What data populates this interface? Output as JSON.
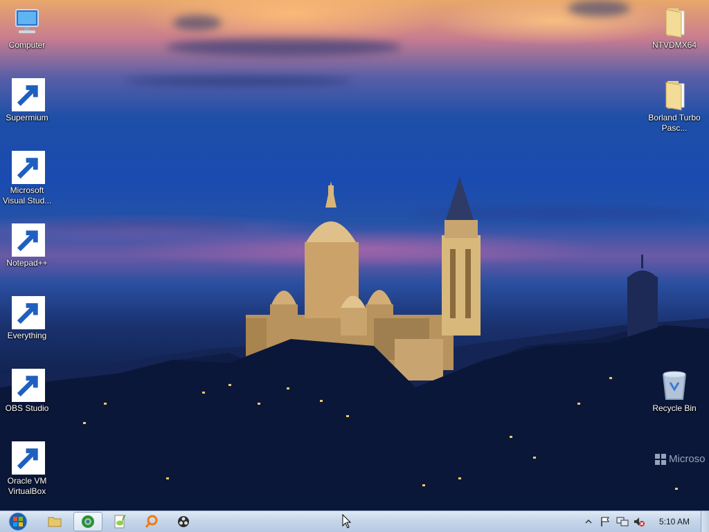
{
  "desktop": {
    "icons_left": [
      {
        "name": "computer-icon",
        "label": "Computer"
      },
      {
        "name": "supermium-icon",
        "label": "Supermium"
      },
      {
        "name": "visual-studio-icon",
        "label": "Microsoft Visual Stud..."
      },
      {
        "name": "notepadpp-icon",
        "label": "Notepad++"
      },
      {
        "name": "everything-icon",
        "label": "Everything"
      },
      {
        "name": "obs-studio-icon",
        "label": "OBS Studio"
      },
      {
        "name": "virtualbox-icon",
        "label": "Oracle VM VirtualBox"
      }
    ],
    "icons_right": [
      {
        "name": "folder-icon",
        "label": "NTVDMX64"
      },
      {
        "name": "folder-icon",
        "label": "Borland Turbo Pasc..."
      },
      {
        "name": "recycle-bin-icon",
        "label": "Recycle Bin"
      }
    ],
    "watermark": "Microso"
  },
  "taskbar": {
    "pinned": [
      "windows-explorer-icon",
      "supermium-icon",
      "notepadpp-icon",
      "everything-icon",
      "obs-studio-icon"
    ],
    "tray": [
      "show-hidden-icons-icon",
      "action-center-flag-icon",
      "network-icon",
      "volume-muted-icon"
    ],
    "clock": "5:10 AM"
  },
  "colors": {
    "taskbar": "#c6d6ea",
    "accent": "#1d4fa8"
  }
}
